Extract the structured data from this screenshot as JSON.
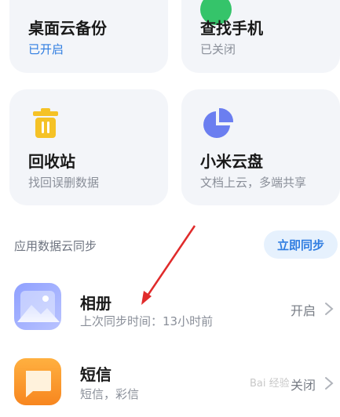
{
  "cards": {
    "desktop_backup": {
      "title": "桌面云备份",
      "status": "已开启"
    },
    "find_phone": {
      "title": "查找手机",
      "status": "已关闭"
    },
    "recycle_bin": {
      "title": "回收站",
      "desc": "找回误删数据"
    },
    "mi_drive": {
      "title": "小米云盘",
      "desc": "文档上云，多端共享"
    }
  },
  "section": {
    "label": "应用数据云同步",
    "sync_now": "立即同步"
  },
  "apps": [
    {
      "name": "相册",
      "desc": "上次同步时间：13小时前",
      "state": "开启"
    },
    {
      "name": "短信",
      "desc": "短信，彩信",
      "state": "关闭"
    }
  ],
  "colors": {
    "card_bg": "#f3f5f9",
    "accent_blue": "#2f7de1",
    "trash_yellow": "#f5c226",
    "pie_purple": "#6b7ef0",
    "arrow_red": "#e02b2b"
  },
  "icons": [
    "trash-icon",
    "pie-chart-icon",
    "gallery-icon",
    "message-icon",
    "chevron-right-icon"
  ],
  "watermark": "Bai 经验"
}
